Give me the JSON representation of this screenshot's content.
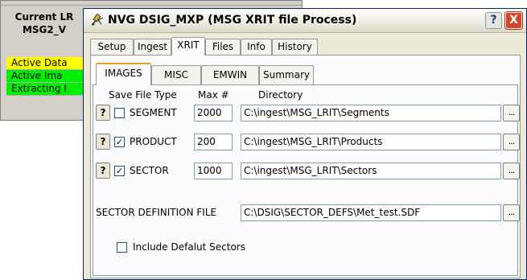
{
  "background_window": {
    "title_line1": "Current LR",
    "title_line2": "MSG2_V",
    "items": [
      {
        "label": "Active Data",
        "color": "#ffff00"
      },
      {
        "label": "Active Ima",
        "color": "#00ee00"
      },
      {
        "label": "Extracting I",
        "color": "#00ee00"
      }
    ]
  },
  "dialog": {
    "title": "NVG DSIG_MXP   (MSG XRIT file Process)",
    "help_label": "?",
    "close_label": "X",
    "outer_tabs": [
      "Setup",
      "Ingest",
      "XRIT",
      "Files",
      "Info",
      "History"
    ],
    "outer_active": "XRIT",
    "inner_tabs": [
      "IMAGES",
      "MISC",
      "EMWIN",
      "Summary"
    ],
    "inner_active": "IMAGES",
    "columns": {
      "save_file_type": "Save File Type",
      "max": "Max #",
      "directory": "Directory"
    },
    "rows": [
      {
        "help": "?",
        "checked": false,
        "check_mark": "",
        "label": "SEGMENT",
        "max": "2000",
        "directory": "C:\\ingest\\MSG_LRIT\\Segments",
        "browse": "..."
      },
      {
        "help": "?",
        "checked": true,
        "check_mark": "✓",
        "label": "PRODUCT",
        "max": "200",
        "directory": "C:\\ingest\\MSG_LRIT\\Products",
        "browse": "..."
      },
      {
        "help": "?",
        "checked": true,
        "check_mark": "✓",
        "label": "SECTOR",
        "max": "1000",
        "directory": "C:\\ingest\\MSG_LRIT\\Sectors",
        "browse": "..."
      }
    ],
    "sector_def": {
      "label": "SECTOR DEFINITION FILE",
      "value": "C:\\DSIG\\SECTOR_DEFS\\Met_test.SDF",
      "browse": "..."
    },
    "include_default": {
      "checked": false,
      "label": "Include Defalut Sectors"
    }
  }
}
